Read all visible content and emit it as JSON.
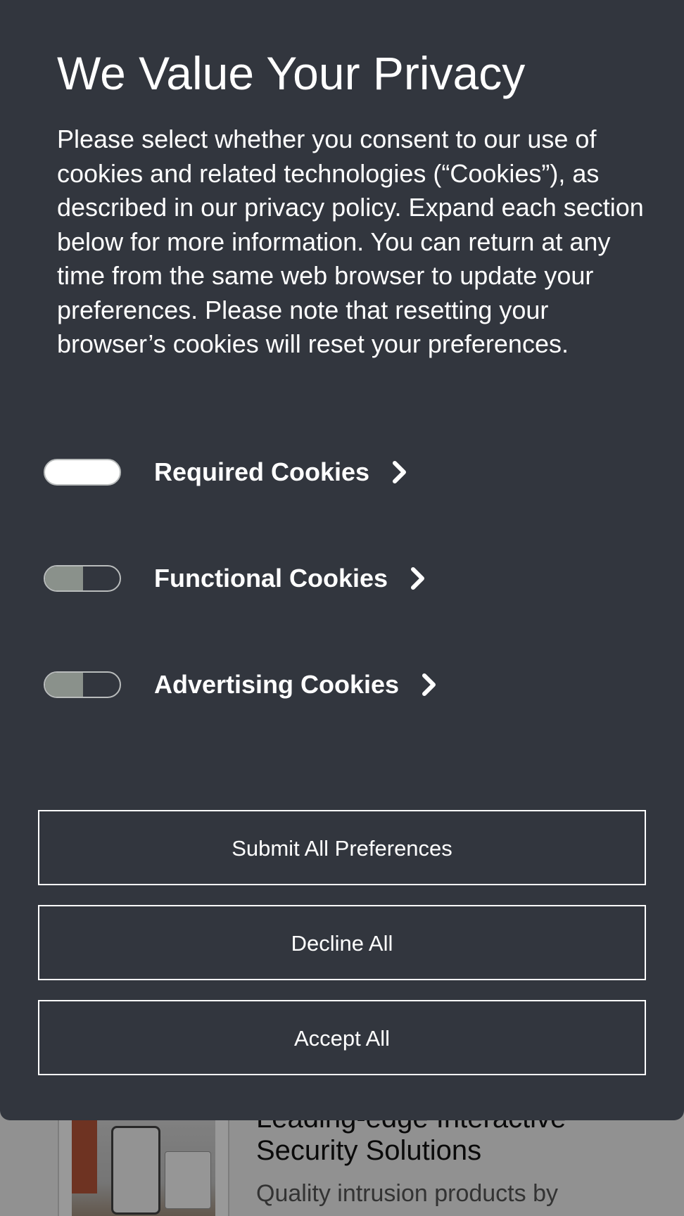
{
  "background": {
    "heading_line1": "Leading-edge Interactive",
    "heading_line2": "Security Solutions",
    "text": "Quality intrusion products by"
  },
  "modal": {
    "title": "We Value Your Privacy",
    "description": "Please select whether you consent to our use of cookies and related technologies (“Cookies”), as described in our privacy policy. Expand each section below for more information. You can return at any time from the same web browser to update your preferences. Please note that resetting your browser’s cookies will reset your preferences.",
    "cookie_categories": [
      {
        "label": "Required Cookies",
        "enabled": true,
        "icon": "chevron-right-icon"
      },
      {
        "label": "Functional Cookies",
        "enabled": false,
        "icon": "chevron-right-icon"
      },
      {
        "label": "Advertising Cookies",
        "enabled": false,
        "icon": "chevron-right-icon"
      }
    ],
    "buttons": {
      "submit": "Submit All Preferences",
      "decline": "Decline All",
      "accept": "Accept All"
    }
  },
  "colors": {
    "modal_background": "#32363e",
    "text": "#ffffff",
    "toggle_off_fill": "#8a918b",
    "toggle_border": "#b9bcbc"
  }
}
